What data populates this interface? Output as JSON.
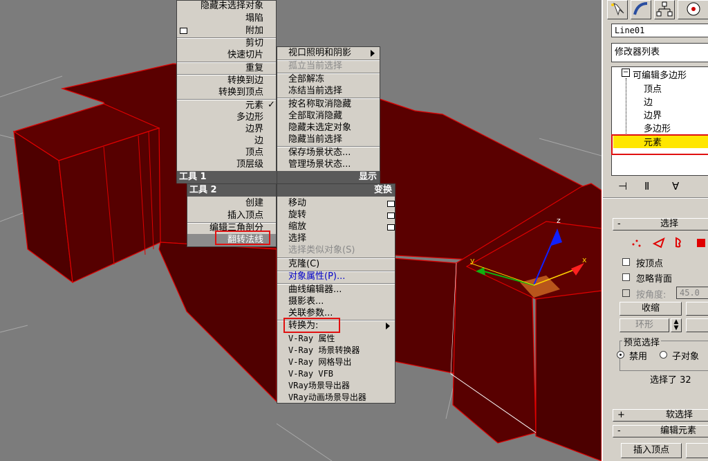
{
  "quad_tl": {
    "items": [
      "隐藏未选择对象",
      "塌陷",
      "附加",
      "剪切",
      "快速切片",
      "重复",
      "转换到边",
      "转换到顶点",
      "元素",
      "多边形",
      "边界",
      "边",
      "顶点",
      "顶层级"
    ],
    "header": "工具 1"
  },
  "quad_tr": {
    "items": [
      "视口照明和阴影",
      "孤立当前选择",
      "全部解冻",
      "冻结当前选择",
      "按名称取消隐藏",
      "全部取消隐藏",
      "隐藏未选定对象",
      "隐藏当前选择",
      "保存场景状态...",
      "管理场景状态..."
    ],
    "header": "显示"
  },
  "quad_bl": {
    "header": "工具 2",
    "items": [
      "创建",
      "插入顶点",
      "编辑三角剖分",
      "翻转法线"
    ]
  },
  "quad_br": {
    "header": "变换",
    "items": [
      "移动",
      "旋转",
      "缩放",
      "选择",
      "选择类似对象(S)",
      "克隆(C)",
      "对象属性(P)...",
      "曲线编辑器...",
      "摄影表...",
      "关联参数...",
      "转换为:",
      "V-Ray 属性",
      "V-Ray 场景转换器",
      "V-Ray 网格导出",
      "V-Ray VFB",
      "VRay场景导出器",
      "VRay动画场景导出器"
    ]
  },
  "gizmo": {
    "x": "x",
    "y": "y",
    "z": "z"
  },
  "panel": {
    "object_name": "Line01",
    "modifier_list": "修改器列表",
    "stack": [
      "可编辑多边形",
      "顶点",
      "边",
      "边界",
      "多边形",
      "元素"
    ],
    "selected_level": "元素",
    "rollout_select": "选择",
    "by_vertex": "按顶点",
    "ignore_backface": "忽略背面",
    "by_angle": "按角度:",
    "angle_value": "45.0",
    "shrink": "收缩",
    "ring": "环形",
    "preview_select": "预览选择",
    "disable": "禁用",
    "sub_object": "子对象",
    "selected_text": "选择了 32",
    "soft_selection": "软选择",
    "edit_elements": "编辑元素",
    "insert_vertex": "插入顶点",
    "plus": "+",
    "minus": "-"
  },
  "colors": {
    "mesh": "#5c0000",
    "edge": "#e00000",
    "menu_bg": "#d4d0c8",
    "highlight": "#ffe600",
    "accent_red": "#e01010"
  }
}
